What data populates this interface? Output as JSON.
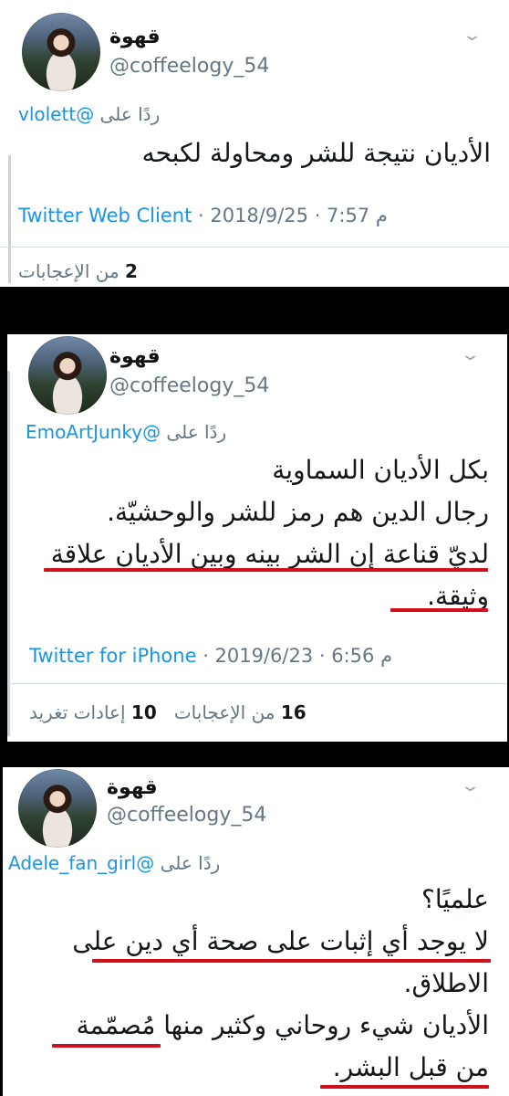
{
  "tweets": [
    {
      "name": "قهوة",
      "handle": "@coffeelogy_54",
      "reply_prefix": "ردًا على",
      "reply_to": "@vlolett",
      "lines": [
        "الأديان نتيجة للشر ومحاولة لكبحه"
      ],
      "source": "Twitter Web Client",
      "datetime": "· 2018/9/25 · 7:57 م",
      "likes_count": "2",
      "likes_label": "من الإعجابات"
    },
    {
      "name": "قهوة",
      "handle": "@coffeelogy_54",
      "reply_prefix": "ردًا على",
      "reply_to": "@EmoArtJunky",
      "lines": [
        "بكل الأديان السماوية",
        "رجال الدين هم رمز للشر والوحشيّة.",
        "لديّ قناعة إن الشر بينه وبين الأديان علاقة",
        "وثيقة."
      ],
      "source": "Twitter for iPhone",
      "datetime": "· 2019/6/23 · 6:56 م",
      "likes_count": "16",
      "likes_label": "من الإعجابات",
      "retweets_count": "10",
      "retweets_label": "إعادات تغريد"
    },
    {
      "name": "قهوة",
      "handle": "@coffeelogy_54",
      "reply_prefix": "ردًا على",
      "reply_to": "@Adele_fan_girl",
      "lines": [
        "علميًا؟",
        "لا يوجد أي إثبات على صحة أي دين على",
        "الاطلاق.",
        "الأديان شيء روحاني وكثير منها مُصمّمة",
        "من قبل البشر."
      ]
    }
  ],
  "colors": {
    "link": "#1b95e0",
    "muted": "#657786",
    "underline": "#d0101c"
  },
  "icons": {
    "menu": "chevron-down-icon"
  }
}
